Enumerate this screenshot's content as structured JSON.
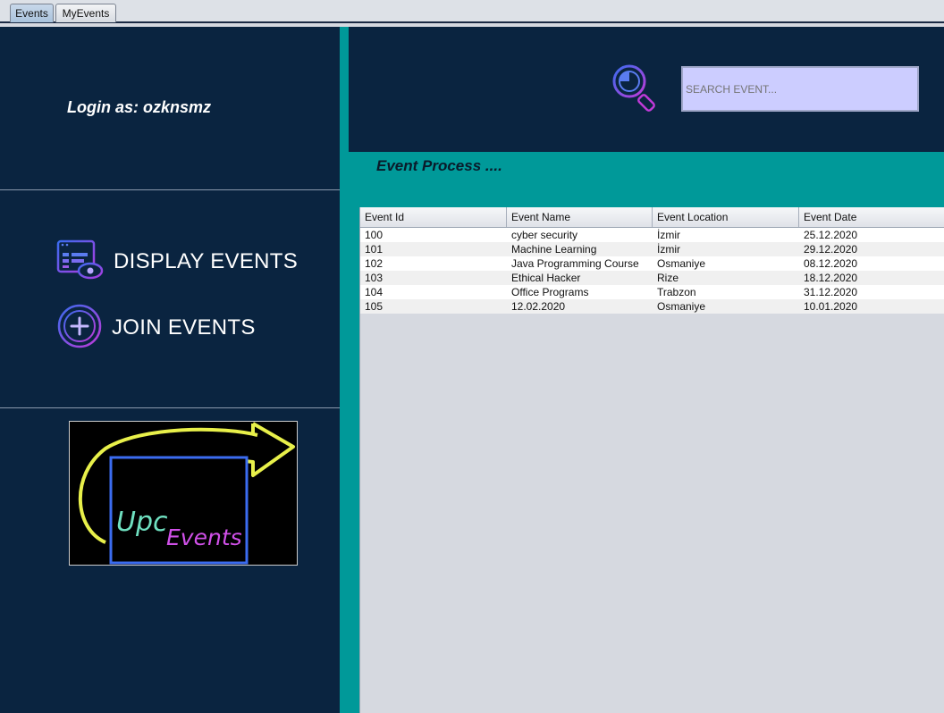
{
  "tabs": [
    {
      "label": "Events",
      "active": true
    },
    {
      "label": "MyEvents",
      "active": false
    }
  ],
  "sidebar": {
    "login_text": "Login as: ozknsmz",
    "menu": [
      {
        "label": "DISPLAY EVENTS",
        "icon": "display-events-icon"
      },
      {
        "label": "JOIN EVENTS",
        "icon": "plus-circle-icon"
      }
    ],
    "logo": {
      "text_upc": "Upc",
      "text_events": "Events"
    }
  },
  "search": {
    "placeholder": "SEARCH EVENT...",
    "icon": "search-icon"
  },
  "main": {
    "title": "Event Process ....",
    "table": {
      "columns": [
        "Event Id",
        "Event Name",
        "Event Location",
        "Event Date"
      ],
      "rows": [
        [
          "100",
          "cyber security",
          "İzmir",
          "25.12.2020"
        ],
        [
          "101",
          "Machine Learning",
          "İzmir",
          "29.12.2020"
        ],
        [
          "102",
          "Java Programming Course",
          "Osmaniye",
          "08.12.2020"
        ],
        [
          "103",
          "Ethical Hacker",
          "Rize",
          "18.12.2020"
        ],
        [
          "104",
          "Office Programs",
          "Trabzon",
          "31.12.2020"
        ],
        [
          "105",
          "12.02.2020",
          "Osmaniye",
          "10.01.2020"
        ]
      ]
    }
  },
  "colors": {
    "navy": "#0a2440",
    "teal": "#009999",
    "search_bg": "#cccdff"
  }
}
